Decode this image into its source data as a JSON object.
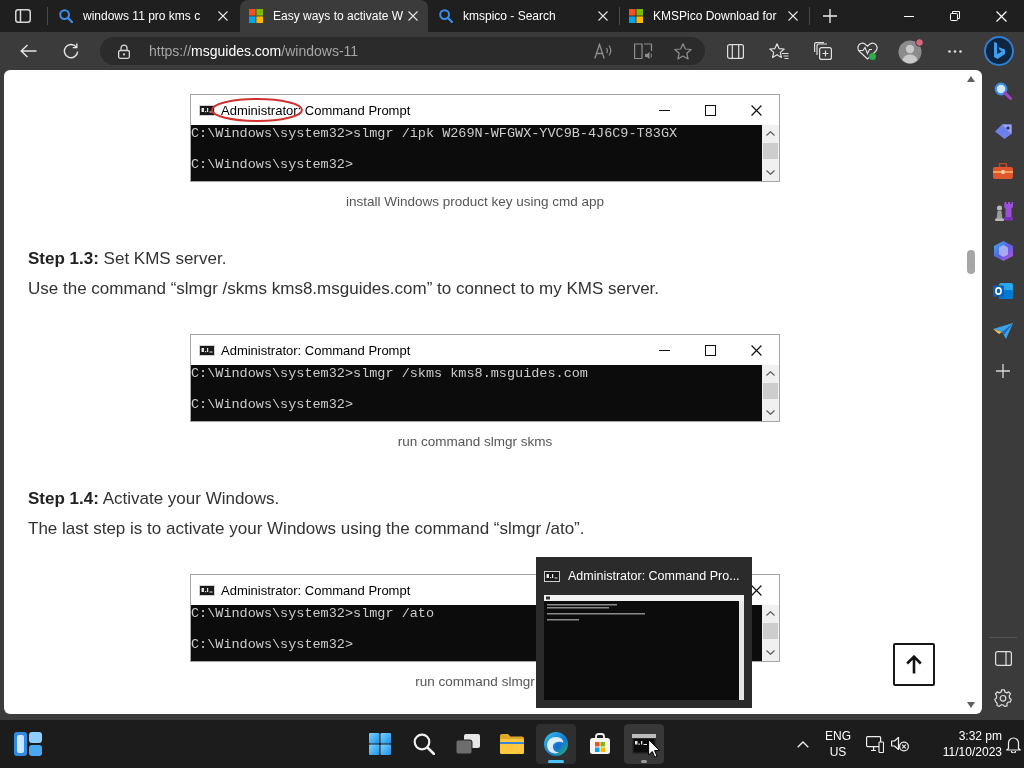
{
  "tabs": [
    {
      "kind": "search",
      "title": "windows 11 pro kms c",
      "selected": false
    },
    {
      "kind": "page",
      "title": "Easy ways to activate W",
      "selected": true
    },
    {
      "kind": "search",
      "title": "kmspico - Search",
      "selected": false
    },
    {
      "kind": "page",
      "title": "KMSPico Download for",
      "selected": false
    }
  ],
  "address_bar": {
    "url": {
      "scheme": "https://",
      "host": "msguides.com",
      "path": "/windows-11"
    }
  },
  "article": {
    "blocks": [
      {
        "kind": "figure",
        "window_title": "Administrator: Command Prompt",
        "circled": true,
        "lines": [
          "C:\\Windows\\system32>slmgr /ipk W269N-WFGWX-YVC9B-4J6C9-T83GX",
          "C:\\Windows\\system32>"
        ],
        "caption": "install Windows product key using cmd app"
      },
      {
        "kind": "step",
        "heading": "**Step 1.3:** Set KMS server.",
        "text": "Use the command “slmgr /skms kms8.msguides.com” to connect to my KMS server."
      },
      {
        "kind": "figure",
        "window_title": "Administrator: Command Prompt",
        "circled": false,
        "lines": [
          "C:\\Windows\\system32>slmgr /skms kms8.msguides.com",
          "C:\\Windows\\system32>"
        ],
        "caption": "run command slmgr skms"
      },
      {
        "kind": "step",
        "heading": "**Step 1.4:** Activate your Windows.",
        "text": "The last step is to activate your Windows using the command “slmgr /ato”."
      },
      {
        "kind": "figure",
        "window_title": "Administrator: Command Prompt",
        "circled": false,
        "lines": [
          "C:\\Windows\\system32>slmgr /ato",
          "C:\\Windows\\system32>"
        ],
        "caption": "run command slmgr"
      }
    ]
  },
  "taskbar_preview": {
    "title": "Administrator: Command Pro..."
  },
  "taskbar": {
    "apps": [
      {
        "selected": false,
        "hovered": false,
        "running": false
      },
      {
        "selected": false,
        "hovered": false,
        "running": false
      },
      {
        "selected": false,
        "hovered": false,
        "running": false
      },
      {
        "selected": false,
        "hovered": false,
        "running": false
      },
      {
        "selected": true,
        "hovered": false,
        "running": true
      },
      {
        "selected": false,
        "hovered": false,
        "running": false
      },
      {
        "selected": false,
        "hovered": true,
        "running": true
      }
    ],
    "language": "ENG",
    "region": "US",
    "time": "3:32 pm",
    "date": "11/10/2023"
  }
}
